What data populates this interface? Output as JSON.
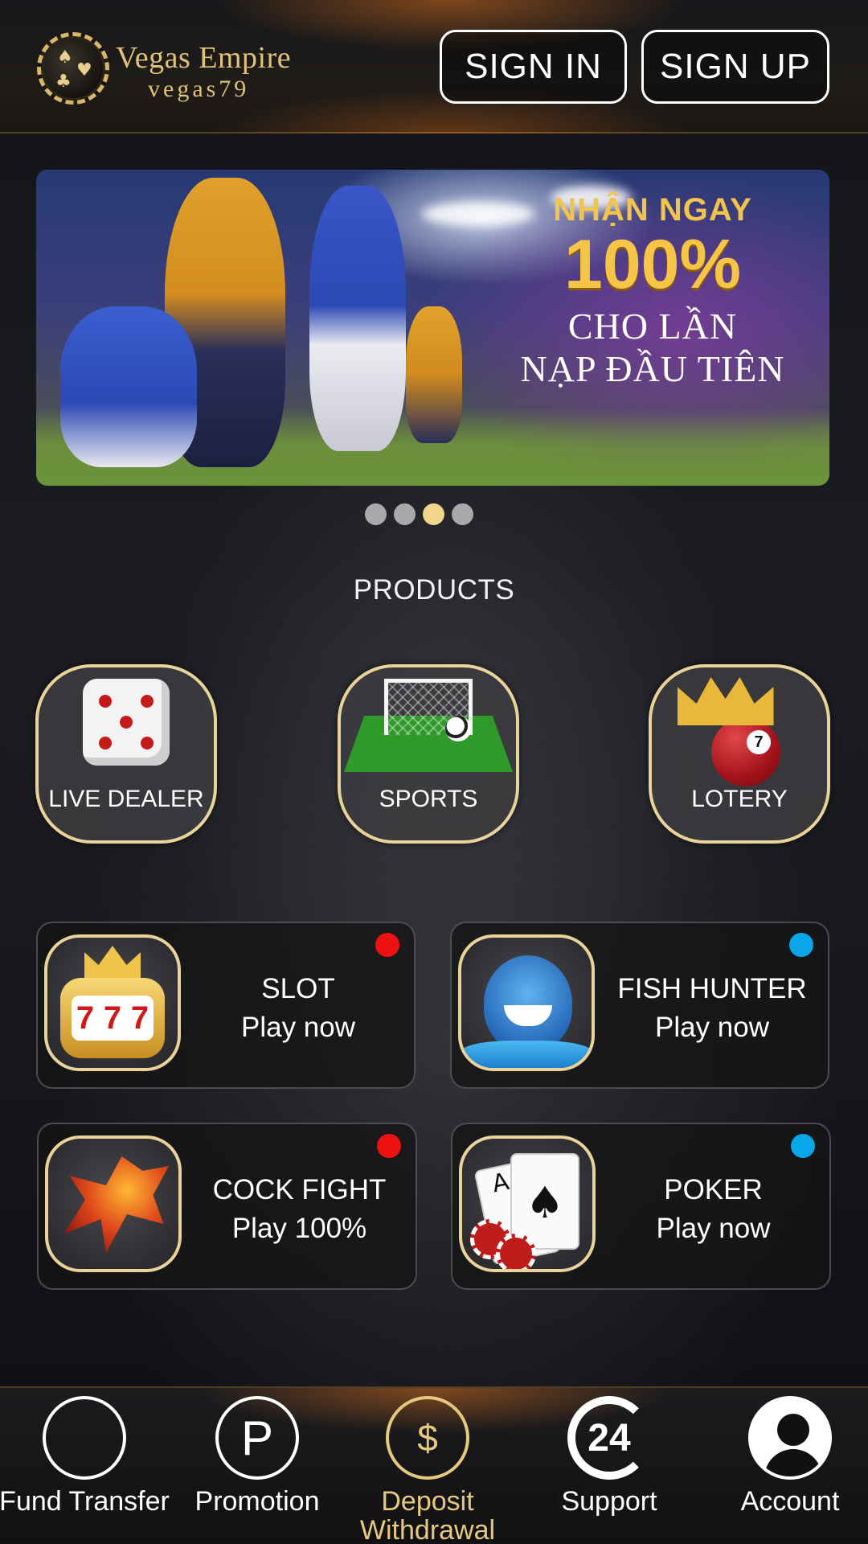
{
  "header": {
    "logo_name": "Vegas Empire",
    "logo_sub": "vegas79",
    "signin_label": "SIGN IN",
    "signup_label": "SIGN UP"
  },
  "banner": {
    "line1": "NHẬN NGAY",
    "line2": "100%",
    "line3": "CHO LẦN",
    "line4": "NẠP ĐẦU TIÊN",
    "slides": 4,
    "active_slide": 3
  },
  "products": {
    "title": "PRODUCTS",
    "items": [
      {
        "label": "LIVE DEALER",
        "icon": "dice-icon"
      },
      {
        "label": "SPORTS",
        "icon": "soccer-field-icon"
      },
      {
        "label": "LOTERY",
        "icon": "lottery-ball-crown-icon"
      }
    ]
  },
  "games": [
    {
      "title": "SLOT",
      "subtitle": "Play now",
      "icon": "slot-machine-icon",
      "indicator": "#ee1111"
    },
    {
      "title": "FISH HUNTER",
      "subtitle": "Play now",
      "icon": "shark-icon",
      "indicator": "#0aa6ea"
    },
    {
      "title": "COCK FIGHT",
      "subtitle": "Play 100%",
      "icon": "phoenix-icon",
      "indicator": "#ee1111"
    },
    {
      "title": "POKER",
      "subtitle": "Play now",
      "icon": "playing-cards-icon",
      "indicator": "#0aa6ea"
    }
  ],
  "bottom_nav": {
    "items": [
      {
        "label": "Fund Transfer",
        "icon": "fund-transfer-icon"
      },
      {
        "label": "Promotion",
        "icon": "promotion-icon",
        "glyph": "P"
      },
      {
        "label": "Deposit\nWithdrawal",
        "icon": "deposit-icon",
        "active": true
      },
      {
        "label": "Support",
        "icon": "support-24-icon",
        "glyph": "24"
      },
      {
        "label": "Account",
        "icon": "account-icon"
      }
    ]
  },
  "colors": {
    "accent_gold": "#e6c97e",
    "indicator_red": "#ee1111",
    "indicator_blue": "#0aa6ea"
  }
}
